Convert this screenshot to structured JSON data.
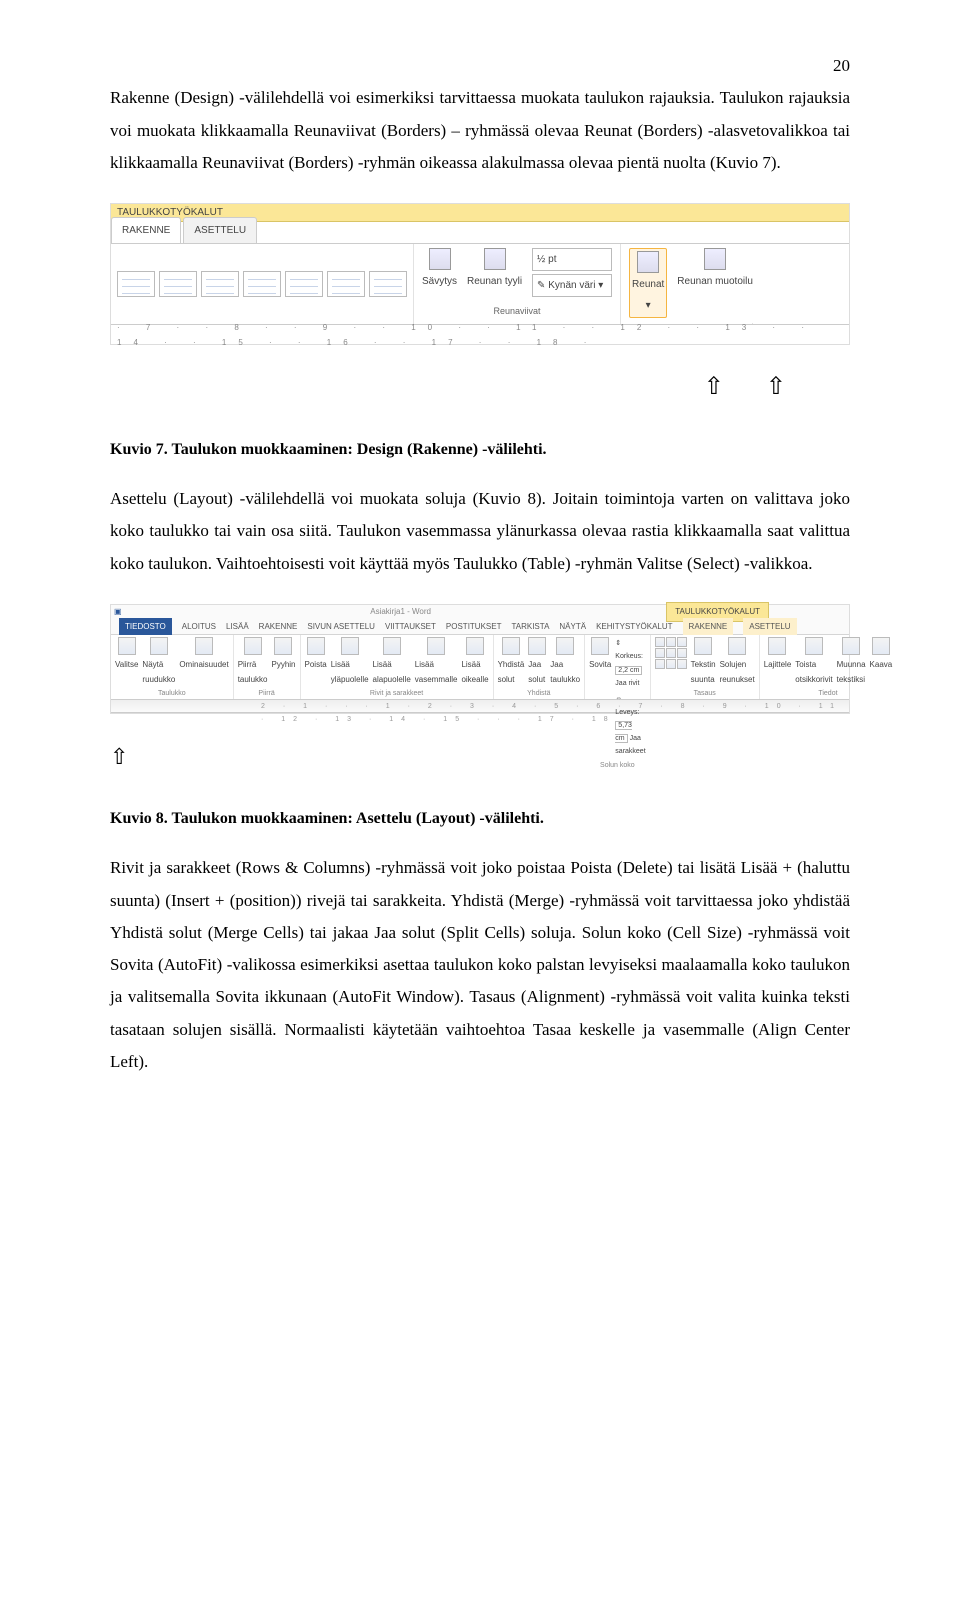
{
  "page_number": "20",
  "para1": "Rakenne (Design) -välilehdellä voi esimerkiksi tarvittaessa muokata taulukon rajauksia. Taulukon rajauksia voi muokata klikkaamalla Reunaviivat (Borders) – ryhmässä olevaa Reunat (Borders) -alasvetovalikkoa tai klikkaamalla Reunaviivat (Borders) -ryhmän oikeassa alakulmassa olevaa pientä nuolta (Kuvio 7).",
  "fig1": {
    "banner": "TAULUKKOTYÖKALUT",
    "tab_design": "RAKENNE",
    "tab_layout": "ASETTELU",
    "savytys": "Sävytys",
    "reunan_tyyli": "Reunan tyyli",
    "weight": "½ pt",
    "pen_color": "Kynän väri",
    "group_borders": "Reunaviivat",
    "reunat": "Reunat",
    "reunan_muotoilu": "Reunan muotoilu",
    "ruler": "· 7 · · 8 · · 9 · · 10 · · 11 · · 12 · · 13 · · 14 · · 15 · · 16 · · 17 · · 18 ·"
  },
  "caption1": "Kuvio 7. Taulukon muokkaaminen: Design (Rakenne) -välilehti.",
  "para2": "Asettelu (Layout) -välilehdellä voi muokata soluja (Kuvio 8). Joitain toimintoja varten on valittava joko koko taulukko tai vain osa siitä. Taulukon vasemmassa ylänurkassa olevaa rastia klikkaamalla saat valittua koko taulukon. Vaihtoehtoisesti voit käyttää myös Taulukko (Table) -ryhmän Valitse (Select) -valikkoa.",
  "fig2": {
    "title_doc": "Asiakirja1 - Word",
    "title_tools": "TAULUKKOTYÖKALUT",
    "menu": [
      "TIEDOSTO",
      "ALOITUS",
      "LISÄÄ",
      "RAKENNE",
      "SIVUN ASETTELU",
      "VIITTAUKSET",
      "POSTITUKSET",
      "TARKISTA",
      "NÄYTÄ",
      "KEHITYSTYÖKALUT",
      "RAKENNE",
      "ASETTELU"
    ],
    "groups": {
      "taulukko": "Taulukko",
      "piirra": "Piirrä",
      "rivit": "Rivit ja sarakkeet",
      "yhdista": "Yhdistä",
      "solun_koko": "Solun koko",
      "tasaus": "Tasaus",
      "tiedot": "Tiedot"
    },
    "btn": {
      "valitse": "Valitse",
      "nayta_ruudukko": "Näytä ruudukko",
      "ominaisuudet": "Ominaisuudet",
      "piirra_taulukko": "Piirrä taulukko",
      "pyyhin": "Pyyhin",
      "poista": "Poista",
      "lisaa_yla": "Lisää yläpuolelle",
      "lisaa_ala": "Lisää alapuolelle",
      "lisaa_vas": "Lisää vasemmalle",
      "lisaa_oik": "Lisää oikealle",
      "yhdista_solut": "Yhdistä solut",
      "jaa_solut": "Jaa solut",
      "jaa_taulukko": "Jaa taulukko",
      "sovita": "Sovita",
      "korkeus": "Korkeus:",
      "korkeus_v": "2,2 cm",
      "leveys": "Leveys:",
      "leveys_v": "5,73 cm",
      "jaa_rivit": "Jaa rivit",
      "jaa_sarakkeet": "Jaa sarakkeet",
      "tekstin_suunta": "Tekstin suunta",
      "solujen_reunukset": "Solujen reunukset",
      "lajittele": "Lajittele",
      "toista": "Toista otsikkorivit",
      "muunna": "Muunna tekstiksi",
      "kaava": "Kaava"
    },
    "ruler": "2 · 1 · · · 1 · 2 · 3 · 4 · 5 · 6 · 7 · 8 · 9 · 10 · 11 · 12 · 13 · 14 · 15 · · · 17 · 18"
  },
  "caption2": "Kuvio 8. Taulukon muokkaaminen: Asettelu (Layout) -välilehti.",
  "para3": "Rivit ja sarakkeet (Rows & Columns) -ryhmässä voit joko poistaa Poista (Delete) tai lisätä Lisää + (haluttu suunta) (Insert + (position)) rivejä tai sarakkeita. Yhdistä (Merge) -ryhmässä voit tarvittaessa joko yhdistää Yhdistä solut (Merge Cells) tai jakaa Jaa solut (Split Cells) soluja. Solun koko (Cell Size) -ryhmässä voit Sovita (AutoFit) -valikossa esimerkiksi asettaa taulukon koko palstan levyiseksi maalaamalla koko taulukon ja valitsemalla Sovita ikkunaan (AutoFit Window). Tasaus (Alignment) -ryhmässä voit valita kuinka teksti tasataan solujen sisällä. Normaalisti käytetään vaihtoehtoa Tasaa keskelle ja vasemmalle (Align Center Left)."
}
